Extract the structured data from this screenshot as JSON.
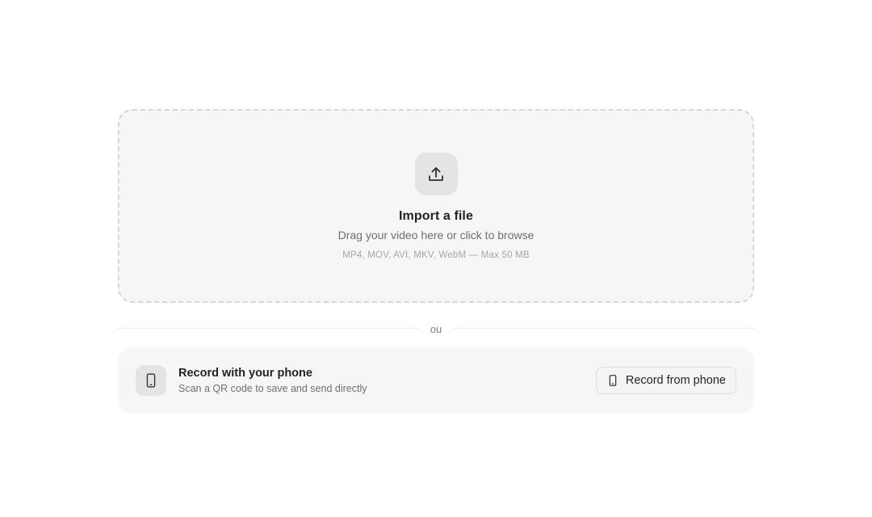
{
  "dropzone": {
    "icon": "upload-icon",
    "title": "Import a file",
    "subtitle": "Drag your video here or click to browse",
    "formats": "MP4, MOV, AVI, MKV, WebM — Max 50 MB"
  },
  "divider": {
    "label": "ou"
  },
  "phone_card": {
    "icon": "smartphone-icon",
    "title": "Record with your phone",
    "subtitle": "Scan a QR code to save and send directly",
    "button_label": "Record from phone",
    "button_icon": "smartphone-icon"
  },
  "colors": {
    "card_background": "#f6f6f6",
    "icon_badge": "#e3e5e5",
    "dashed_border": "#d5d7d9",
    "text_primary": "#1f2328",
    "text_secondary": "#6b7075",
    "text_muted": "#a3a7ab"
  }
}
